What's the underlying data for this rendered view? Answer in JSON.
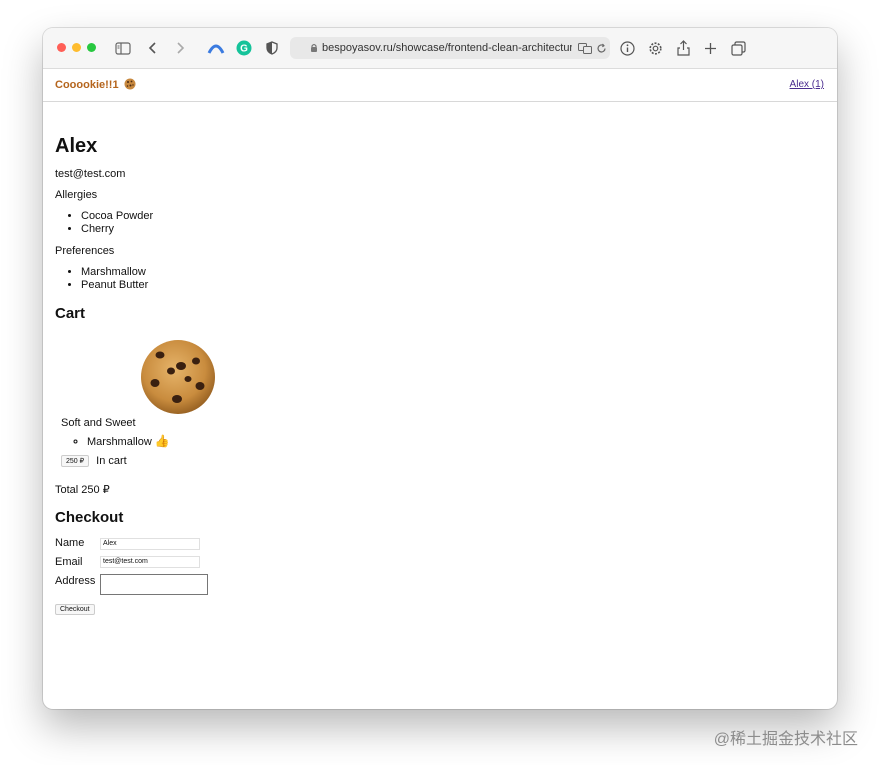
{
  "browser": {
    "url": "bespoyasov.ru/showcase/frontend-clean-architecture"
  },
  "header": {
    "brand": "Cooookie!!1",
    "brand_emoji": "🍪",
    "user_link": "Alex (1)"
  },
  "profile": {
    "name": "Alex",
    "email": "test@test.com",
    "allergies_label": "Allergies",
    "allergies": [
      "Cocoa Powder",
      "Cherry"
    ],
    "preferences_label": "Preferences",
    "preferences": [
      "Marshmallow",
      "Peanut Butter"
    ]
  },
  "cart": {
    "title": "Cart",
    "item": {
      "name": "Soft and Sweet",
      "toppings": [
        "Marshmallow"
      ],
      "topping_emoji": "👍",
      "price_label": "250 ₽",
      "status": "In cart"
    },
    "total": "Total 250 ₽"
  },
  "checkout": {
    "title": "Checkout",
    "name_label": "Name",
    "name_value": "Alex",
    "email_label": "Email",
    "email_value": "test@test.com",
    "address_label": "Address",
    "address_value": "",
    "button_label": "Checkout"
  },
  "watermark": "@稀土掘金技术社区"
}
